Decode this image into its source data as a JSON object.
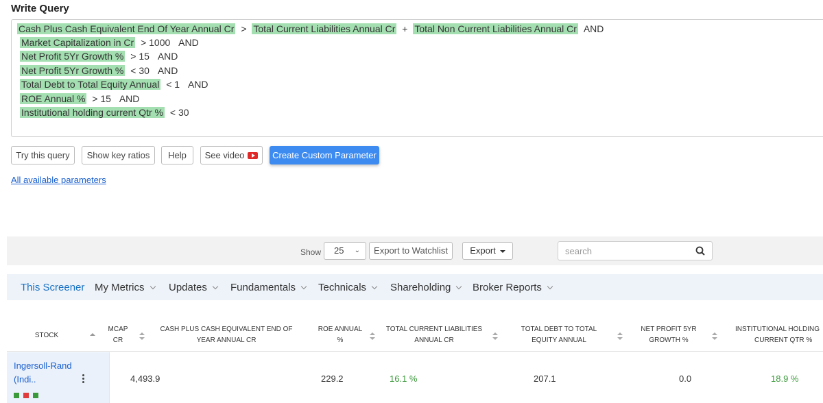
{
  "title": "Write Query",
  "query": {
    "line1": {
      "p1": "Cash Plus Cash Equivalent End Of Year Annual Cr",
      "op1": ">",
      "p2": "Total Current Liabilities Annual Cr",
      "op2": "+",
      "p3": "Total Non Current Liabilities Annual Cr",
      "join": "AND"
    },
    "lines": [
      {
        "param": "Market Capitalization in Cr",
        "cond": "> 1000",
        "join": "AND"
      },
      {
        "param": "Net Profit 5Yr Growth %",
        "cond": "> 15",
        "join": "AND"
      },
      {
        "param": "Net Profit 5Yr Growth %",
        "cond": "< 30",
        "join": "AND"
      },
      {
        "param": "Total Debt to Total Equity Annual",
        "cond": "< 1",
        "join": "AND"
      },
      {
        "param": "ROE Annual %",
        "cond": "> 15",
        "join": "AND"
      },
      {
        "param": "Institutional holding current Qtr %",
        "cond": "< 30",
        "join": ""
      }
    ]
  },
  "buttons": {
    "try": "Try this query",
    "key_ratios": "Show key ratios",
    "help": "Help",
    "video": "See video",
    "custom": "Create Custom Parameter"
  },
  "all_params_link": "All available parameters",
  "toolbar": {
    "show_label": "Show",
    "page_size": "25",
    "export_watchlist": "Export to Watchlist",
    "export": "Export",
    "search_placeholder": "search"
  },
  "tabs": [
    "This Screener",
    "My Metrics",
    "Updates",
    "Fundamentals",
    "Technicals",
    "Shareholding",
    "Broker Reports"
  ],
  "columns": {
    "stock": "Stock",
    "mcap_1": "MCAP",
    "mcap_2": "Cr",
    "cash_1": "Cash Plus Cash Equivalent End Of",
    "cash_2": "Year Annual Cr",
    "roe_1": "ROE Annual",
    "roe_2": "%",
    "tcl_1": "Total Current Liabilities",
    "tcl_2": "Annual Cr",
    "tdte_1": "Total Debt to Total",
    "tdte_2": "Equity Annual",
    "np_1": "Net Profit 5Yr",
    "np_2": "Growth %",
    "inst_1": "Institutional Holding",
    "inst_2": "Current Qtr %"
  },
  "row": {
    "name_1": "Ingersoll-Rand",
    "name_2": "(Indi..",
    "mcap": "4,493.9",
    "roe": "229.2",
    "tcl": "16.1 %",
    "tdte": "207.1",
    "np": "0.0",
    "inst": "18.9 %"
  },
  "colors": {
    "highlight": "#a3dfb0",
    "primary": "#3d8bf0",
    "link": "#1a5fcf",
    "green": "#3c9a3c",
    "dot_green": "#3a9a3a",
    "dot_red": "#e03c3c"
  }
}
